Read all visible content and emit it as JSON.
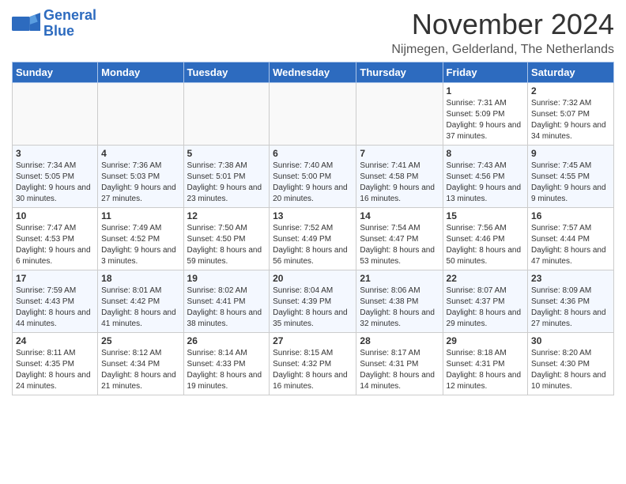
{
  "header": {
    "logo_line1": "General",
    "logo_line2": "Blue",
    "month": "November 2024",
    "location": "Nijmegen, Gelderland, The Netherlands"
  },
  "weekdays": [
    "Sunday",
    "Monday",
    "Tuesday",
    "Wednesday",
    "Thursday",
    "Friday",
    "Saturday"
  ],
  "weeks": [
    [
      {
        "day": "",
        "info": ""
      },
      {
        "day": "",
        "info": ""
      },
      {
        "day": "",
        "info": ""
      },
      {
        "day": "",
        "info": ""
      },
      {
        "day": "",
        "info": ""
      },
      {
        "day": "1",
        "info": "Sunrise: 7:31 AM\nSunset: 5:09 PM\nDaylight: 9 hours and 37 minutes."
      },
      {
        "day": "2",
        "info": "Sunrise: 7:32 AM\nSunset: 5:07 PM\nDaylight: 9 hours and 34 minutes."
      }
    ],
    [
      {
        "day": "3",
        "info": "Sunrise: 7:34 AM\nSunset: 5:05 PM\nDaylight: 9 hours and 30 minutes."
      },
      {
        "day": "4",
        "info": "Sunrise: 7:36 AM\nSunset: 5:03 PM\nDaylight: 9 hours and 27 minutes."
      },
      {
        "day": "5",
        "info": "Sunrise: 7:38 AM\nSunset: 5:01 PM\nDaylight: 9 hours and 23 minutes."
      },
      {
        "day": "6",
        "info": "Sunrise: 7:40 AM\nSunset: 5:00 PM\nDaylight: 9 hours and 20 minutes."
      },
      {
        "day": "7",
        "info": "Sunrise: 7:41 AM\nSunset: 4:58 PM\nDaylight: 9 hours and 16 minutes."
      },
      {
        "day": "8",
        "info": "Sunrise: 7:43 AM\nSunset: 4:56 PM\nDaylight: 9 hours and 13 minutes."
      },
      {
        "day": "9",
        "info": "Sunrise: 7:45 AM\nSunset: 4:55 PM\nDaylight: 9 hours and 9 minutes."
      }
    ],
    [
      {
        "day": "10",
        "info": "Sunrise: 7:47 AM\nSunset: 4:53 PM\nDaylight: 9 hours and 6 minutes."
      },
      {
        "day": "11",
        "info": "Sunrise: 7:49 AM\nSunset: 4:52 PM\nDaylight: 9 hours and 3 minutes."
      },
      {
        "day": "12",
        "info": "Sunrise: 7:50 AM\nSunset: 4:50 PM\nDaylight: 8 hours and 59 minutes."
      },
      {
        "day": "13",
        "info": "Sunrise: 7:52 AM\nSunset: 4:49 PM\nDaylight: 8 hours and 56 minutes."
      },
      {
        "day": "14",
        "info": "Sunrise: 7:54 AM\nSunset: 4:47 PM\nDaylight: 8 hours and 53 minutes."
      },
      {
        "day": "15",
        "info": "Sunrise: 7:56 AM\nSunset: 4:46 PM\nDaylight: 8 hours and 50 minutes."
      },
      {
        "day": "16",
        "info": "Sunrise: 7:57 AM\nSunset: 4:44 PM\nDaylight: 8 hours and 47 minutes."
      }
    ],
    [
      {
        "day": "17",
        "info": "Sunrise: 7:59 AM\nSunset: 4:43 PM\nDaylight: 8 hours and 44 minutes."
      },
      {
        "day": "18",
        "info": "Sunrise: 8:01 AM\nSunset: 4:42 PM\nDaylight: 8 hours and 41 minutes."
      },
      {
        "day": "19",
        "info": "Sunrise: 8:02 AM\nSunset: 4:41 PM\nDaylight: 8 hours and 38 minutes."
      },
      {
        "day": "20",
        "info": "Sunrise: 8:04 AM\nSunset: 4:39 PM\nDaylight: 8 hours and 35 minutes."
      },
      {
        "day": "21",
        "info": "Sunrise: 8:06 AM\nSunset: 4:38 PM\nDaylight: 8 hours and 32 minutes."
      },
      {
        "day": "22",
        "info": "Sunrise: 8:07 AM\nSunset: 4:37 PM\nDaylight: 8 hours and 29 minutes."
      },
      {
        "day": "23",
        "info": "Sunrise: 8:09 AM\nSunset: 4:36 PM\nDaylight: 8 hours and 27 minutes."
      }
    ],
    [
      {
        "day": "24",
        "info": "Sunrise: 8:11 AM\nSunset: 4:35 PM\nDaylight: 8 hours and 24 minutes."
      },
      {
        "day": "25",
        "info": "Sunrise: 8:12 AM\nSunset: 4:34 PM\nDaylight: 8 hours and 21 minutes."
      },
      {
        "day": "26",
        "info": "Sunrise: 8:14 AM\nSunset: 4:33 PM\nDaylight: 8 hours and 19 minutes."
      },
      {
        "day": "27",
        "info": "Sunrise: 8:15 AM\nSunset: 4:32 PM\nDaylight: 8 hours and 16 minutes."
      },
      {
        "day": "28",
        "info": "Sunrise: 8:17 AM\nSunset: 4:31 PM\nDaylight: 8 hours and 14 minutes."
      },
      {
        "day": "29",
        "info": "Sunrise: 8:18 AM\nSunset: 4:31 PM\nDaylight: 8 hours and 12 minutes."
      },
      {
        "day": "30",
        "info": "Sunrise: 8:20 AM\nSunset: 4:30 PM\nDaylight: 8 hours and 10 minutes."
      }
    ]
  ]
}
